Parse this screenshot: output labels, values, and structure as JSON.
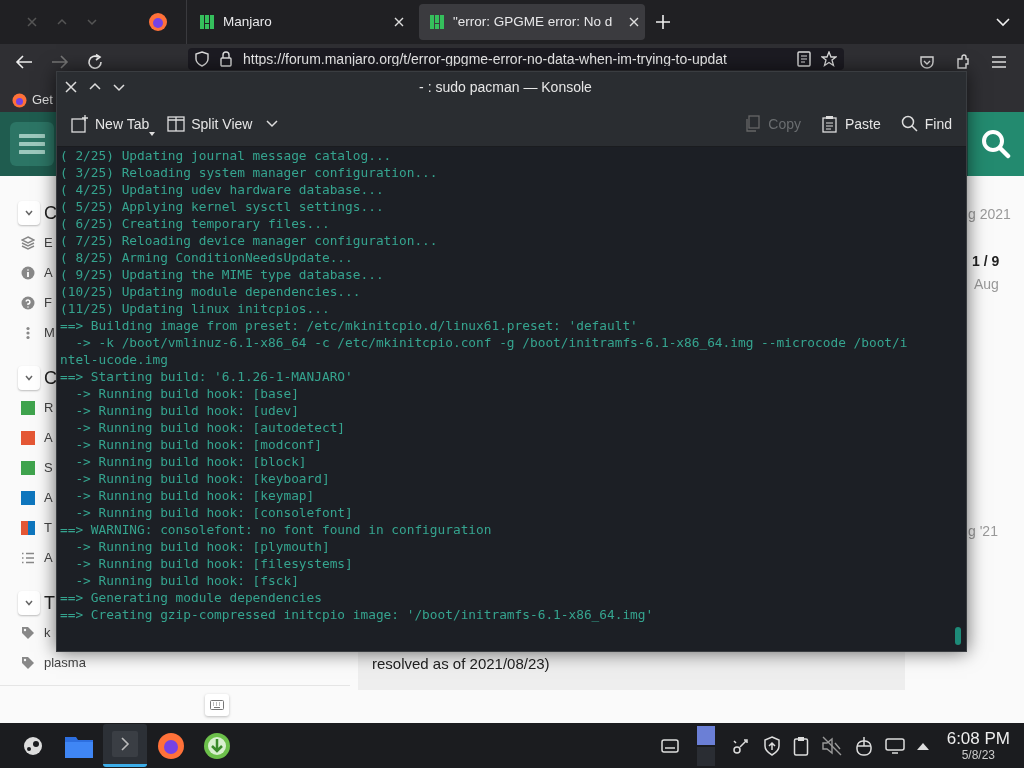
{
  "browser": {
    "tabs": [
      {
        "label": "Manjaro",
        "selected": false
      },
      {
        "label": "\"error: GPGME error: No d",
        "selected": true
      }
    ],
    "url": "https://forum.manjaro.org/t/error-gpgme-error-no-data-when-im-trying-to-updat",
    "bookmark": "Get"
  },
  "forum": {
    "sidebar": [
      {
        "title": "C",
        "expanded": true,
        "items": [
          {
            "kind": "layers",
            "label": "E"
          },
          {
            "kind": "info",
            "label": "A"
          },
          {
            "kind": "help",
            "label": "F"
          },
          {
            "kind": "more",
            "label": "M"
          }
        ]
      },
      {
        "title": "C",
        "expanded": true,
        "items": [
          {
            "kind": "category",
            "label": "R",
            "color": "#3fa34d"
          },
          {
            "kind": "category",
            "label": "A",
            "color": "#e45735"
          },
          {
            "kind": "category",
            "label": "S",
            "color": "#3fa34d"
          },
          {
            "kind": "category",
            "label": "A",
            "color": "#0e76bd"
          },
          {
            "kind": "category",
            "label": "T",
            "color": "#0e76bd",
            "parent": {
              "color": "#e45735"
            }
          },
          {
            "kind": "list",
            "label": "A"
          }
        ]
      },
      {
        "title": "T",
        "expanded": true,
        "items": [
          {
            "kind": "tag",
            "label": "k"
          },
          {
            "kind": "tag",
            "label": "plasma"
          }
        ]
      }
    ],
    "timeline": {
      "date_top": "g 2021",
      "position": "1 / 9",
      "date_current": "Aug",
      "date_bottom": "g '21"
    },
    "post_excerpt": "resolved as of 2021/08/23)"
  },
  "konsole": {
    "title": "- : sudo pacman — Konsole",
    "toolbar_left": [
      {
        "kind": "new-tab",
        "label": "New Tab",
        "disabled": false
      },
      {
        "kind": "split",
        "label": "Split View",
        "disabled": false
      }
    ],
    "toolbar_right": [
      {
        "kind": "copy",
        "label": "Copy",
        "disabled": true
      },
      {
        "kind": "paste",
        "label": "Paste",
        "disabled": false
      },
      {
        "kind": "find",
        "label": "Find",
        "disabled": false
      }
    ],
    "lines": [
      "( 2/25) Updating journal message catalog...",
      "( 3/25) Reloading system manager configuration...",
      "( 4/25) Updating udev hardware database...",
      "( 5/25) Applying kernel sysctl settings...",
      "( 6/25) Creating temporary files...",
      "( 7/25) Reloading device manager configuration...",
      "( 8/25) Arming ConditionNeedsUpdate...",
      "( 9/25) Updating the MIME type database...",
      "(10/25) Updating module dependencies...",
      "(11/25) Updating linux initcpios...",
      "==> Building image from preset: /etc/mkinitcpio.d/linux61.preset: 'default'",
      "  -> -k /boot/vmlinuz-6.1-x86_64 -c /etc/mkinitcpio.conf -g /boot/initramfs-6.1-x86_64.img --microcode /boot/i",
      "ntel-ucode.img",
      "==> Starting build: '6.1.26-1-MANJARO'",
      "  -> Running build hook: [base]",
      "  -> Running build hook: [udev]",
      "  -> Running build hook: [autodetect]",
      "  -> Running build hook: [modconf]",
      "  -> Running build hook: [block]",
      "  -> Running build hook: [keyboard]",
      "  -> Running build hook: [keymap]",
      "  -> Running build hook: [consolefont]",
      "==> WARNING: consolefont: no font found in configuration",
      "  -> Running build hook: [plymouth]",
      "  -> Running build hook: [filesystems]",
      "  -> Running build hook: [fsck]",
      "==> Generating module dependencies",
      "==> Creating gzip-compressed initcpio image: '/boot/initramfs-6.1-x86_64.img'"
    ]
  },
  "taskbar": {
    "apps": [
      {
        "kind": "game",
        "active": false
      },
      {
        "kind": "folder",
        "active": false
      },
      {
        "kind": "terminal",
        "active": true
      },
      {
        "kind": "browser",
        "active": false
      },
      {
        "kind": "download",
        "active": false
      }
    ],
    "time": "6:08 PM",
    "date": "5/8/23"
  }
}
